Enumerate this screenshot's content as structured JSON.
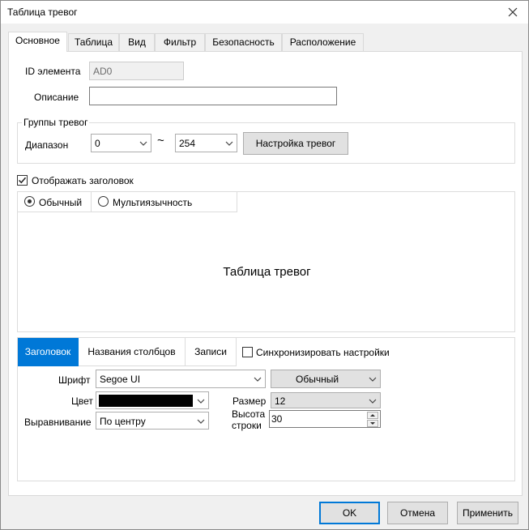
{
  "window": {
    "title": "Таблица тревог"
  },
  "tabs": [
    {
      "label": "Основное"
    },
    {
      "label": "Таблица"
    },
    {
      "label": "Вид"
    },
    {
      "label": "Фильтр"
    },
    {
      "label": "Безопасность"
    },
    {
      "label": "Расположение"
    }
  ],
  "general": {
    "id_label": "ID элемента",
    "id_value": "AD0",
    "description_label": "Описание",
    "description_value": ""
  },
  "alarm_groups": {
    "title": "Группы тревог",
    "range_label": "Диапазон",
    "range_from": "0",
    "range_separator": "~",
    "range_to": "254",
    "settings_button": "Настройка тревог"
  },
  "show_header": {
    "label": "Отображать заголовок",
    "checked": true
  },
  "preview": {
    "mode_normal": "Обычный",
    "mode_multilang": "Мультиязычность",
    "title": "Таблица тревог"
  },
  "settings": {
    "tabs": [
      "Заголовок",
      "Названия столбцов",
      "Записи"
    ],
    "sync_label": "Синхронизировать настройки",
    "font_label": "Шрифт",
    "font_value": "Segoe UI",
    "style_value": "Обычный",
    "color_label": "Цвет",
    "color_value": "#000000",
    "size_label": "Размер",
    "size_value": "12",
    "align_label": "Выравнивание",
    "align_value": "По центру",
    "row_height_label_1": "Высота",
    "row_height_label_2": "строки",
    "row_height_value": "30"
  },
  "footer": {
    "ok": "OK",
    "cancel": "Отмена",
    "apply": "Применить"
  }
}
